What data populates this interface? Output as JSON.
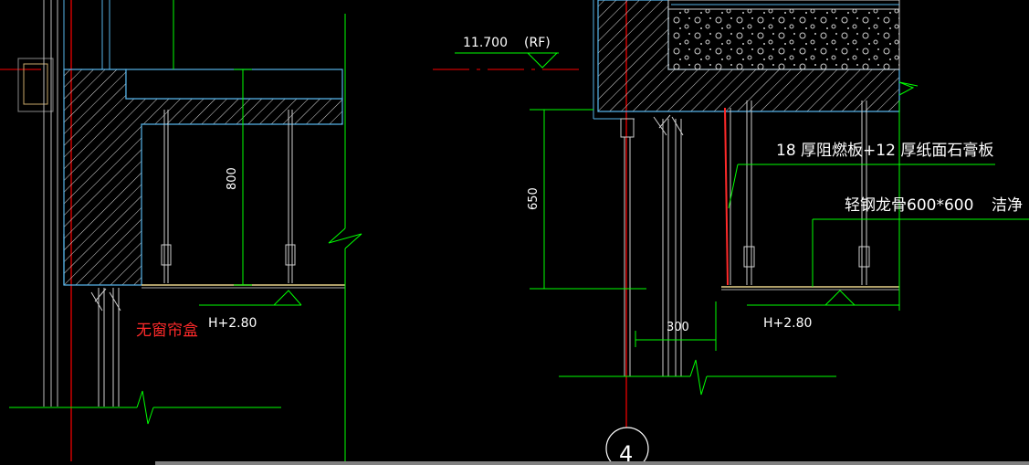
{
  "drawing": {
    "background": "#000000",
    "colors": {
      "wall": "#ffffff",
      "hatch": "#ffffff",
      "outline_cyan": "#56b4e9",
      "dim_green": "#00ff00",
      "axis_red": "#ff0000",
      "ceiling_yellow": "#e8d38a",
      "note_red": "#ff2a2a"
    },
    "left": {
      "dimension_vertical": "800",
      "level_label": "H+2.80",
      "note": "无窗帘盒"
    },
    "right": {
      "roof_elevation": "11.700",
      "roof_tag": "(RF)",
      "dimension_vertical": "650",
      "dimension_horizontal": "300",
      "level_label": "H+2.80",
      "callout_1": "18 厚阻燃板+12 厚纸面石膏板",
      "callout_2": "轻钢龙骨600*600",
      "callout_3": "洁净",
      "detail_number": "4"
    }
  }
}
